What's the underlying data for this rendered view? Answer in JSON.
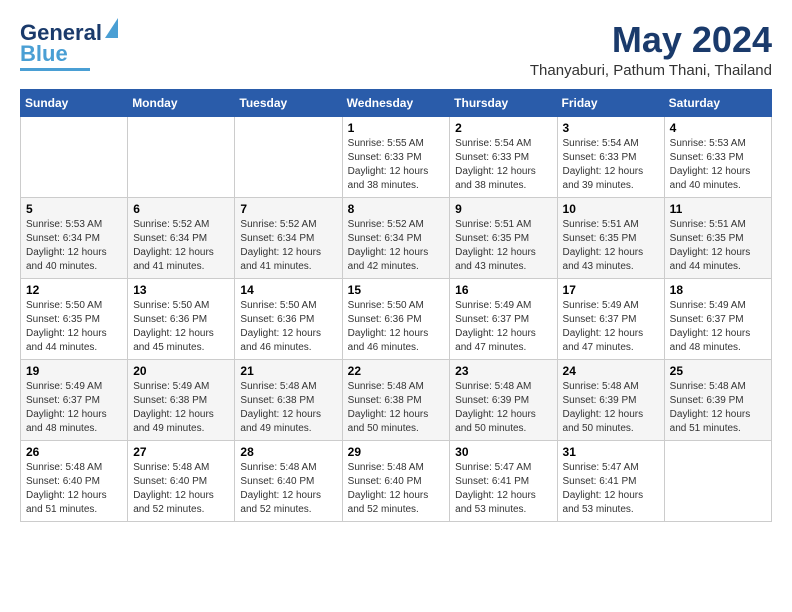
{
  "header": {
    "logo_line1": "General",
    "logo_line2": "Blue",
    "main_title": "May 2024",
    "subtitle": "Thanyaburi, Pathum Thani, Thailand"
  },
  "calendar": {
    "days_of_week": [
      "Sunday",
      "Monday",
      "Tuesday",
      "Wednesday",
      "Thursday",
      "Friday",
      "Saturday"
    ],
    "weeks": [
      [
        {
          "day": "",
          "info": ""
        },
        {
          "day": "",
          "info": ""
        },
        {
          "day": "",
          "info": ""
        },
        {
          "day": "1",
          "info": "Sunrise: 5:55 AM\nSunset: 6:33 PM\nDaylight: 12 hours\nand 38 minutes."
        },
        {
          "day": "2",
          "info": "Sunrise: 5:54 AM\nSunset: 6:33 PM\nDaylight: 12 hours\nand 38 minutes."
        },
        {
          "day": "3",
          "info": "Sunrise: 5:54 AM\nSunset: 6:33 PM\nDaylight: 12 hours\nand 39 minutes."
        },
        {
          "day": "4",
          "info": "Sunrise: 5:53 AM\nSunset: 6:33 PM\nDaylight: 12 hours\nand 40 minutes."
        }
      ],
      [
        {
          "day": "5",
          "info": "Sunrise: 5:53 AM\nSunset: 6:34 PM\nDaylight: 12 hours\nand 40 minutes."
        },
        {
          "day": "6",
          "info": "Sunrise: 5:52 AM\nSunset: 6:34 PM\nDaylight: 12 hours\nand 41 minutes."
        },
        {
          "day": "7",
          "info": "Sunrise: 5:52 AM\nSunset: 6:34 PM\nDaylight: 12 hours\nand 41 minutes."
        },
        {
          "day": "8",
          "info": "Sunrise: 5:52 AM\nSunset: 6:34 PM\nDaylight: 12 hours\nand 42 minutes."
        },
        {
          "day": "9",
          "info": "Sunrise: 5:51 AM\nSunset: 6:35 PM\nDaylight: 12 hours\nand 43 minutes."
        },
        {
          "day": "10",
          "info": "Sunrise: 5:51 AM\nSunset: 6:35 PM\nDaylight: 12 hours\nand 43 minutes."
        },
        {
          "day": "11",
          "info": "Sunrise: 5:51 AM\nSunset: 6:35 PM\nDaylight: 12 hours\nand 44 minutes."
        }
      ],
      [
        {
          "day": "12",
          "info": "Sunrise: 5:50 AM\nSunset: 6:35 PM\nDaylight: 12 hours\nand 44 minutes."
        },
        {
          "day": "13",
          "info": "Sunrise: 5:50 AM\nSunset: 6:36 PM\nDaylight: 12 hours\nand 45 minutes."
        },
        {
          "day": "14",
          "info": "Sunrise: 5:50 AM\nSunset: 6:36 PM\nDaylight: 12 hours\nand 46 minutes."
        },
        {
          "day": "15",
          "info": "Sunrise: 5:50 AM\nSunset: 6:36 PM\nDaylight: 12 hours\nand 46 minutes."
        },
        {
          "day": "16",
          "info": "Sunrise: 5:49 AM\nSunset: 6:37 PM\nDaylight: 12 hours\nand 47 minutes."
        },
        {
          "day": "17",
          "info": "Sunrise: 5:49 AM\nSunset: 6:37 PM\nDaylight: 12 hours\nand 47 minutes."
        },
        {
          "day": "18",
          "info": "Sunrise: 5:49 AM\nSunset: 6:37 PM\nDaylight: 12 hours\nand 48 minutes."
        }
      ],
      [
        {
          "day": "19",
          "info": "Sunrise: 5:49 AM\nSunset: 6:37 PM\nDaylight: 12 hours\nand 48 minutes."
        },
        {
          "day": "20",
          "info": "Sunrise: 5:49 AM\nSunset: 6:38 PM\nDaylight: 12 hours\nand 49 minutes."
        },
        {
          "day": "21",
          "info": "Sunrise: 5:48 AM\nSunset: 6:38 PM\nDaylight: 12 hours\nand 49 minutes."
        },
        {
          "day": "22",
          "info": "Sunrise: 5:48 AM\nSunset: 6:38 PM\nDaylight: 12 hours\nand 50 minutes."
        },
        {
          "day": "23",
          "info": "Sunrise: 5:48 AM\nSunset: 6:39 PM\nDaylight: 12 hours\nand 50 minutes."
        },
        {
          "day": "24",
          "info": "Sunrise: 5:48 AM\nSunset: 6:39 PM\nDaylight: 12 hours\nand 50 minutes."
        },
        {
          "day": "25",
          "info": "Sunrise: 5:48 AM\nSunset: 6:39 PM\nDaylight: 12 hours\nand 51 minutes."
        }
      ],
      [
        {
          "day": "26",
          "info": "Sunrise: 5:48 AM\nSunset: 6:40 PM\nDaylight: 12 hours\nand 51 minutes."
        },
        {
          "day": "27",
          "info": "Sunrise: 5:48 AM\nSunset: 6:40 PM\nDaylight: 12 hours\nand 52 minutes."
        },
        {
          "day": "28",
          "info": "Sunrise: 5:48 AM\nSunset: 6:40 PM\nDaylight: 12 hours\nand 52 minutes."
        },
        {
          "day": "29",
          "info": "Sunrise: 5:48 AM\nSunset: 6:40 PM\nDaylight: 12 hours\nand 52 minutes."
        },
        {
          "day": "30",
          "info": "Sunrise: 5:47 AM\nSunset: 6:41 PM\nDaylight: 12 hours\nand 53 minutes."
        },
        {
          "day": "31",
          "info": "Sunrise: 5:47 AM\nSunset: 6:41 PM\nDaylight: 12 hours\nand 53 minutes."
        },
        {
          "day": "",
          "info": ""
        }
      ]
    ]
  }
}
